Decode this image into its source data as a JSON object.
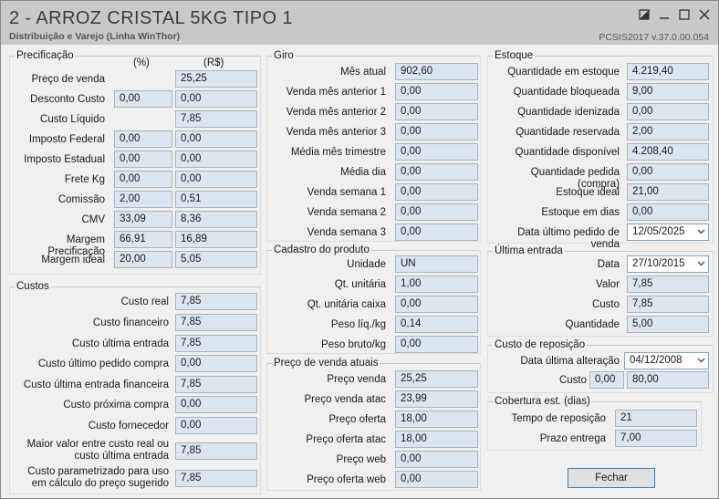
{
  "window": {
    "title": "2 - ARROZ CRISTAL 5KG TIPO 1",
    "subtitle": "Distribuição e Varejo (Linha WinThor)",
    "version": "PCSIS2017  v.37.0.00.054"
  },
  "precificacao": {
    "title": "Precificação",
    "col_pct": "(%)",
    "col_rs": "(R$)",
    "rows": [
      {
        "label": "Preço de venda",
        "pct": null,
        "rs": "25,25"
      },
      {
        "label": "Desconto Custo",
        "pct": "0,00",
        "rs": "0,00"
      },
      {
        "label": "Custo Líquido",
        "pct": null,
        "rs": "7,85"
      },
      {
        "label": "Imposto Federal",
        "pct": "0,00",
        "rs": "0,00"
      },
      {
        "label": "Imposto Estadual",
        "pct": "0,00",
        "rs": "0,00"
      },
      {
        "label": "Frete Kg",
        "pct": "0,00",
        "rs": "0,00"
      },
      {
        "label": "Comissão",
        "pct": "2,00",
        "rs": "0,51"
      },
      {
        "label": "CMV",
        "pct": "33,09",
        "rs": "8,36"
      },
      {
        "label": "Margem Precificação",
        "pct": "66,91",
        "rs": "16,89"
      },
      {
        "label": "Margem ideal",
        "pct": "20,00",
        "rs": "5,05"
      }
    ]
  },
  "custos": {
    "title": "Custos",
    "rows": [
      {
        "label": "Custo real",
        "value": "7,85"
      },
      {
        "label": "Custo financeiro",
        "value": "7,85"
      },
      {
        "label": "Custo última entrada",
        "value": "7,85"
      },
      {
        "label": "Custo último pedido compra",
        "value": "0,00"
      },
      {
        "label": "Custo última entrada financeira",
        "value": "7,85"
      },
      {
        "label": "Custo próxima compra",
        "value": "0,00"
      },
      {
        "label": "Custo fornecedor",
        "value": "0,00"
      },
      {
        "label": "Maior valor entre custo real ou",
        "label2": "custo última entrada",
        "value": "7,85"
      },
      {
        "label": "Custo parametrizado para uso",
        "label2": "em cálculo do preço sugerido",
        "value": "7,85"
      }
    ]
  },
  "giro": {
    "title": "Giro",
    "rows": [
      {
        "label": "Mês atual",
        "value": "902,60"
      },
      {
        "label": "Venda mês anterior 1",
        "value": "0,00"
      },
      {
        "label": "Venda mês anterior 2",
        "value": "0,00"
      },
      {
        "label": "Venda mês anterior 3",
        "value": "0,00"
      },
      {
        "label": "Média mês trimestre",
        "value": "0,00"
      },
      {
        "label": "Média dia",
        "value": "0,00"
      },
      {
        "label": "Venda semana 1",
        "value": "0,00"
      },
      {
        "label": "Venda semana 2",
        "value": "0,00"
      },
      {
        "label": "Venda semana 3",
        "value": "0,00"
      }
    ]
  },
  "cadastro": {
    "title": "Cadastro do produto",
    "rows": [
      {
        "label": "Unidade",
        "value": "UN"
      },
      {
        "label": "Qt. unitária",
        "value": "1,00"
      },
      {
        "label": "Qt. unitária caixa",
        "value": "0,00"
      },
      {
        "label": "Peso líq./kg",
        "value": "0,14"
      },
      {
        "label": "Peso bruto/kg",
        "value": "0,00"
      }
    ]
  },
  "precos": {
    "title": "Preço de venda atuais",
    "rows": [
      {
        "label": "Preço venda",
        "value": "25,25"
      },
      {
        "label": "Preço venda atac",
        "value": "23,99"
      },
      {
        "label": "Preço oferta",
        "value": "18,00"
      },
      {
        "label": "Preço oferta atac",
        "value": "18,00"
      },
      {
        "label": "Preço web",
        "value": "0,00"
      },
      {
        "label": "Preço oferta web",
        "value": "0,00"
      }
    ]
  },
  "estoque": {
    "title": "Estoque",
    "rows": [
      {
        "label": "Quantidade em estoque",
        "value": "4.219,40"
      },
      {
        "label": "Quantidade bloqueada",
        "value": "9,00"
      },
      {
        "label": "Quantidade idenizada",
        "value": "0,00"
      },
      {
        "label": "Quantidade reservada",
        "value": "2,00"
      },
      {
        "label": "Quantidade disponível",
        "value": "4.208,40"
      },
      {
        "label": "Quantidade pedida (compra)",
        "value": "0,00"
      },
      {
        "label": "Estoque ideal",
        "value": "21,00"
      },
      {
        "label": "Estoque em dias",
        "value": "0,00"
      },
      {
        "label": "Data último pedido de venda",
        "value": "12/05/2025"
      }
    ]
  },
  "ultima_entrada": {
    "title": "Última entrada",
    "rows": [
      {
        "label": "Data",
        "value": "27/10/2015"
      },
      {
        "label": "Valor",
        "value": "7,85"
      },
      {
        "label": "Custo",
        "value": "7,85"
      },
      {
        "label": "Quantidade",
        "value": "5,00"
      }
    ]
  },
  "reposicao": {
    "title": "Custo de reposição",
    "data_label": "Data última alteração",
    "data_value": "04/12/2008",
    "custo_label": "Custo",
    "custo_pct": "0,00",
    "custo_value": "80,00"
  },
  "cobertura": {
    "title": "Cobertura est. (dias)",
    "rows": [
      {
        "label": "Tempo de reposição",
        "value": "21"
      },
      {
        "label": "Prazo entrega",
        "value": "7,00"
      }
    ]
  },
  "buttons": {
    "close": "Fechar"
  },
  "icons": {
    "restore": "restore-icon",
    "minimize": "minimize-icon",
    "maximize": "maximize-icon",
    "close": "close-icon",
    "dropdown": "chevron-down-icon"
  }
}
